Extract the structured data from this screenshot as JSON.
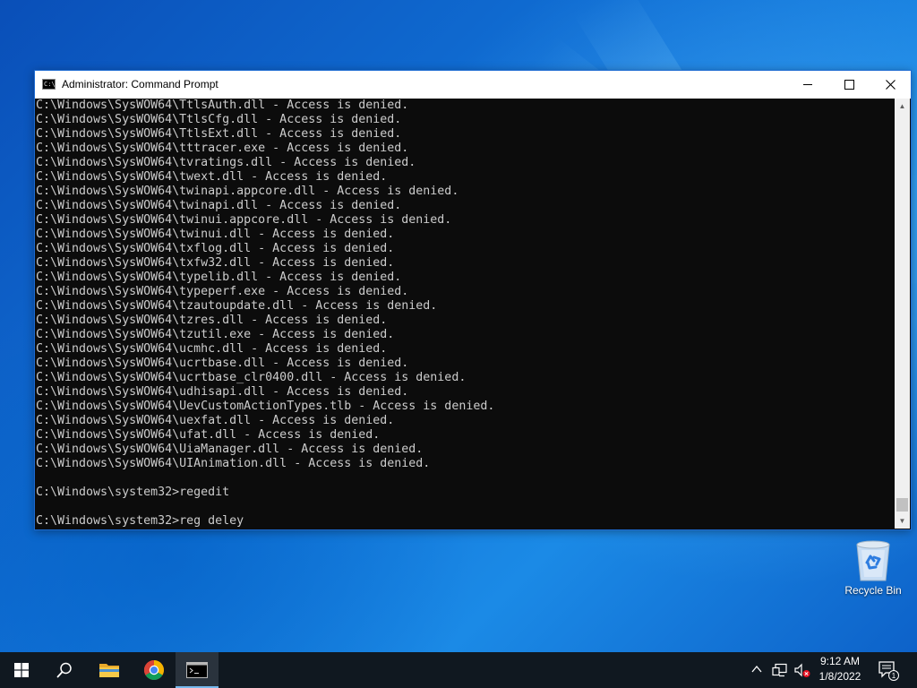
{
  "window": {
    "title": "Administrator: Command Prompt",
    "icon_text": "C:\\"
  },
  "console": {
    "lines": [
      "C:\\Windows\\SysWOW64\\TtlsAuth.dll - Access is denied.",
      "C:\\Windows\\SysWOW64\\TtlsCfg.dll - Access is denied.",
      "C:\\Windows\\SysWOW64\\TtlsExt.dll - Access is denied.",
      "C:\\Windows\\SysWOW64\\tttracer.exe - Access is denied.",
      "C:\\Windows\\SysWOW64\\tvratings.dll - Access is denied.",
      "C:\\Windows\\SysWOW64\\twext.dll - Access is denied.",
      "C:\\Windows\\SysWOW64\\twinapi.appcore.dll - Access is denied.",
      "C:\\Windows\\SysWOW64\\twinapi.dll - Access is denied.",
      "C:\\Windows\\SysWOW64\\twinui.appcore.dll - Access is denied.",
      "C:\\Windows\\SysWOW64\\twinui.dll - Access is denied.",
      "C:\\Windows\\SysWOW64\\txflog.dll - Access is denied.",
      "C:\\Windows\\SysWOW64\\txfw32.dll - Access is denied.",
      "C:\\Windows\\SysWOW64\\typelib.dll - Access is denied.",
      "C:\\Windows\\SysWOW64\\typeperf.exe - Access is denied.",
      "C:\\Windows\\SysWOW64\\tzautoupdate.dll - Access is denied.",
      "C:\\Windows\\SysWOW64\\tzres.dll - Access is denied.",
      "C:\\Windows\\SysWOW64\\tzutil.exe - Access is denied.",
      "C:\\Windows\\SysWOW64\\ucmhc.dll - Access is denied.",
      "C:\\Windows\\SysWOW64\\ucrtbase.dll - Access is denied.",
      "C:\\Windows\\SysWOW64\\ucrtbase_clr0400.dll - Access is denied.",
      "C:\\Windows\\SysWOW64\\udhisapi.dll - Access is denied.",
      "C:\\Windows\\SysWOW64\\UevCustomActionTypes.tlb - Access is denied.",
      "C:\\Windows\\SysWOW64\\uexfat.dll - Access is denied.",
      "C:\\Windows\\SysWOW64\\ufat.dll - Access is denied.",
      "C:\\Windows\\SysWOW64\\UiaManager.dll - Access is denied.",
      "C:\\Windows\\SysWOW64\\UIAnimation.dll - Access is denied.",
      "",
      "C:\\Windows\\system32>regedit",
      "",
      "C:\\Windows\\system32>reg deley"
    ]
  },
  "desktop": {
    "recycle_bin_label": "Recycle Bin"
  },
  "taskbar": {
    "clock_time": "9:12 AM",
    "clock_date": "1/8/2022",
    "notification_count": "1",
    "pinned": [
      "start",
      "search",
      "file-explorer",
      "chrome",
      "command-prompt"
    ]
  },
  "colors": {
    "console_bg": "#0c0c0c",
    "console_text": "#cccccc",
    "taskbar_bg": "#101820",
    "accent": "#76b9ed"
  }
}
